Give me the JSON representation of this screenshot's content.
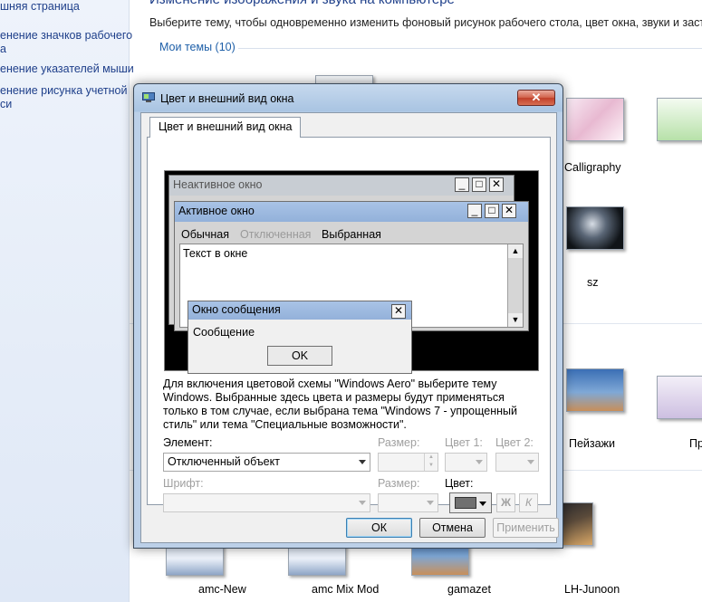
{
  "left_panel": {
    "links": [
      "шняя страница",
      "енение значков рабочего",
      "а",
      "енение указателей мыши",
      "енение рисунка учетной",
      "си"
    ]
  },
  "main": {
    "title": "Изменение изображения и звука на компьютере",
    "description": "Выберите тему, чтобы одновременно изменить фоновый рисунок рабочего стола, цвет окна, звуки и заставку",
    "group_label": "Мои темы (10)",
    "theme_labels": {
      "calligraphy": "Calligraphy",
      "sz": "sz",
      "peizazhi": "Пейзажи",
      "pr": "Пр",
      "amc_new": "amc-New",
      "amc_mix_mod": "amc Mix Mod",
      "gamazet": "gamazet",
      "lh_junoon": "LH-Junoon"
    }
  },
  "dialog": {
    "title": "Цвет и внешний вид окна",
    "close_glyph": "✕",
    "tab_label": "Цвет и внешний вид окна",
    "preview": {
      "inactive_title": "Неактивное окно",
      "active_title": "Активное окно",
      "menu_normal": "Обычная",
      "menu_disabled": "Отключенная",
      "menu_selected": "Выбранная",
      "window_text": "Текст в окне",
      "msgbox_title": "Окно сообщения",
      "msgbox_text": "Сообщение",
      "msgbox_ok": "OK",
      "btn_min": "_",
      "btn_max": "□",
      "btn_close": "✕"
    },
    "info_text": "Для включения цветовой схемы \"Windows Aero\" выберите тему Windows. Выбранные здесь цвета и размеры будут применяться только в том случае, если выбрана тема \"Windows 7 - упрощенный стиль\" или тема \"Специальные возможности\".",
    "element_label": "Элемент:",
    "element_value": "Отключенный объект",
    "size1_label": "Размер:",
    "color1_label": "Цвет 1:",
    "color2_label": "Цвет 2:",
    "font_label": "Шрифт:",
    "size2_label": "Размер:",
    "color_label": "Цвет:",
    "bold_label": "Ж",
    "italic_label": "К",
    "ok_button": "ОК",
    "cancel_button": "Отмена",
    "apply_button": "Применить",
    "colors": {
      "text_color": "#707070"
    }
  }
}
